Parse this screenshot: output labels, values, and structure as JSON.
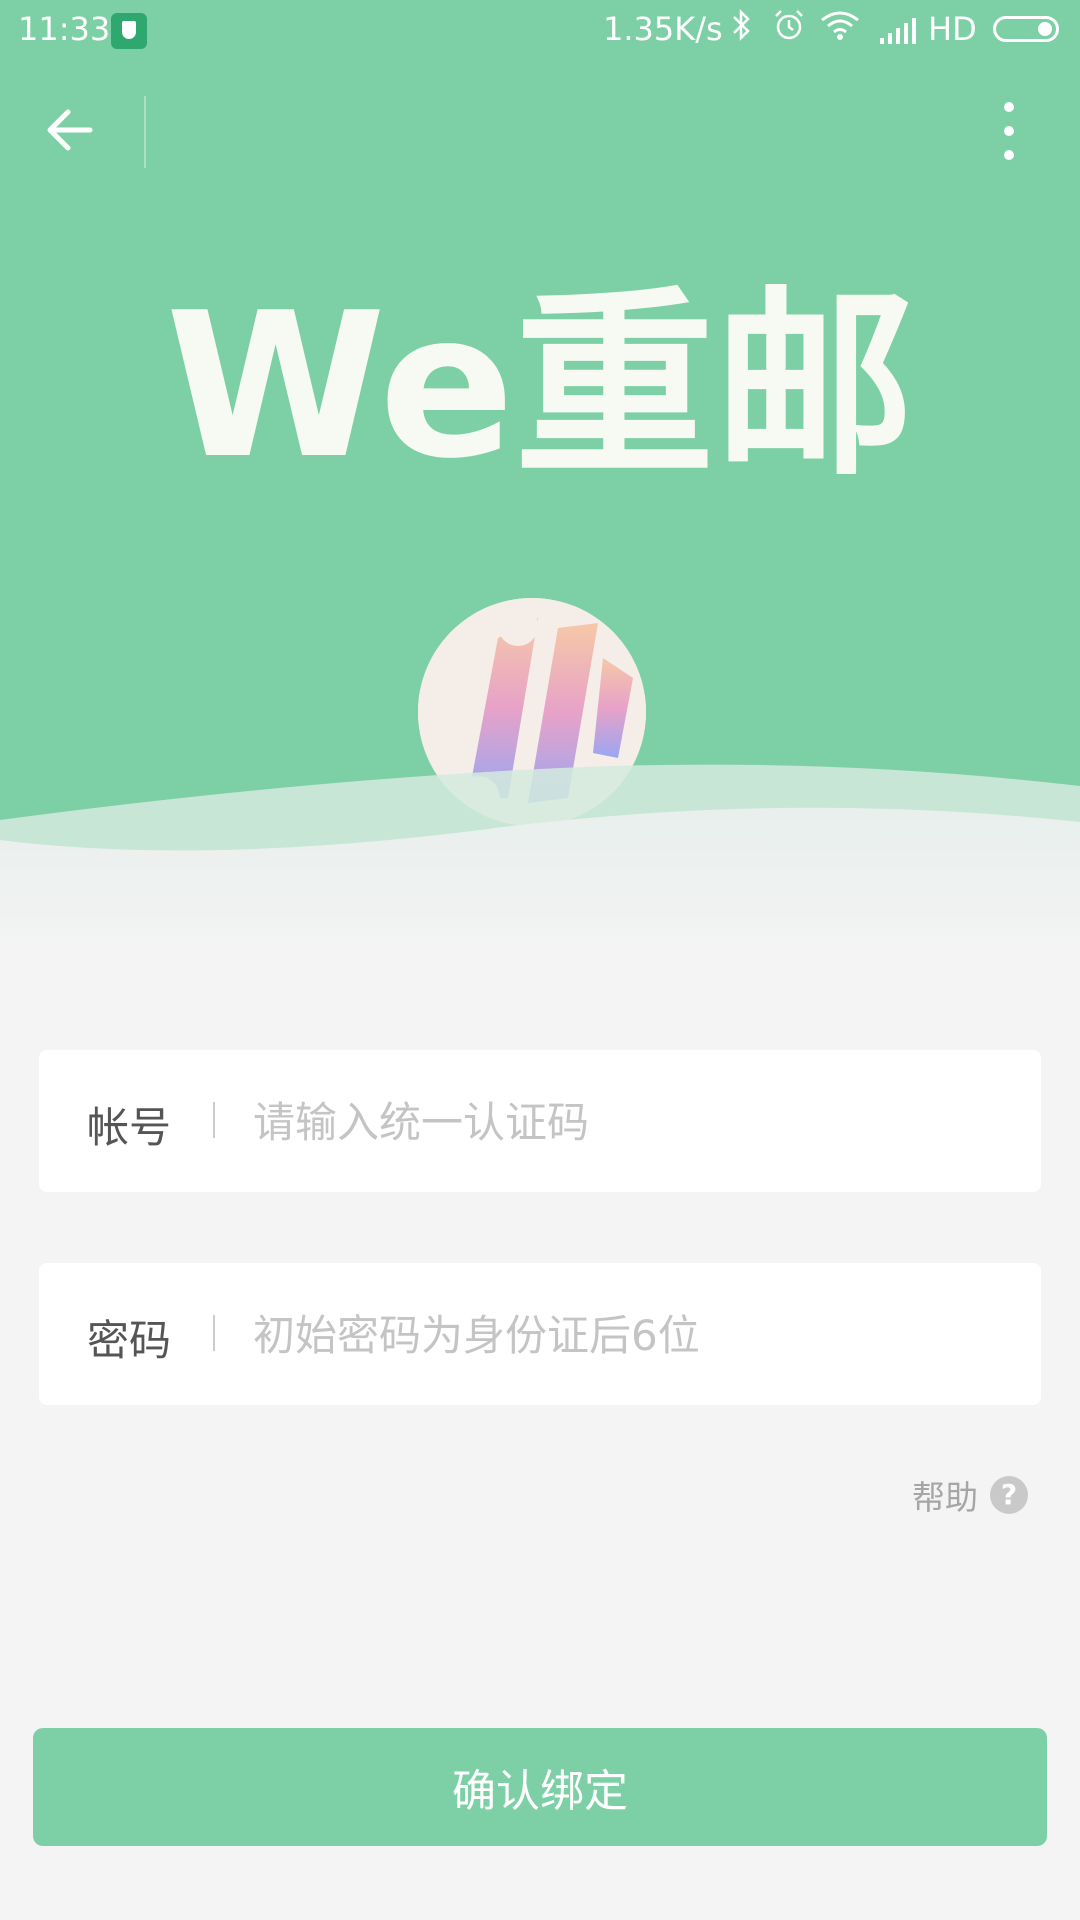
{
  "status_bar": {
    "time": "11:33",
    "network_speed": "1.35K/s",
    "network_type": "HD",
    "icons": [
      "shield-app-icon",
      "bluetooth-icon",
      "alarm-icon",
      "wifi-icon",
      "signal-icon",
      "battery-icon"
    ]
  },
  "nav": {
    "back_icon": "arrow-left-icon",
    "more_icon": "more-vertical-icon"
  },
  "brand": {
    "logo_text": "We重邮"
  },
  "form": {
    "account": {
      "label": "帐号",
      "placeholder": "请输入统一认证码",
      "value": ""
    },
    "password": {
      "label": "密码",
      "placeholder": "初始密码为身份证后6位",
      "value": ""
    },
    "help_label": "帮助",
    "help_icon_glyph": "?",
    "submit_label": "确认绑定"
  },
  "colors": {
    "accent": "#7dd0a5",
    "background": "#f4f4f4",
    "placeholder": "#c4c4c4"
  }
}
